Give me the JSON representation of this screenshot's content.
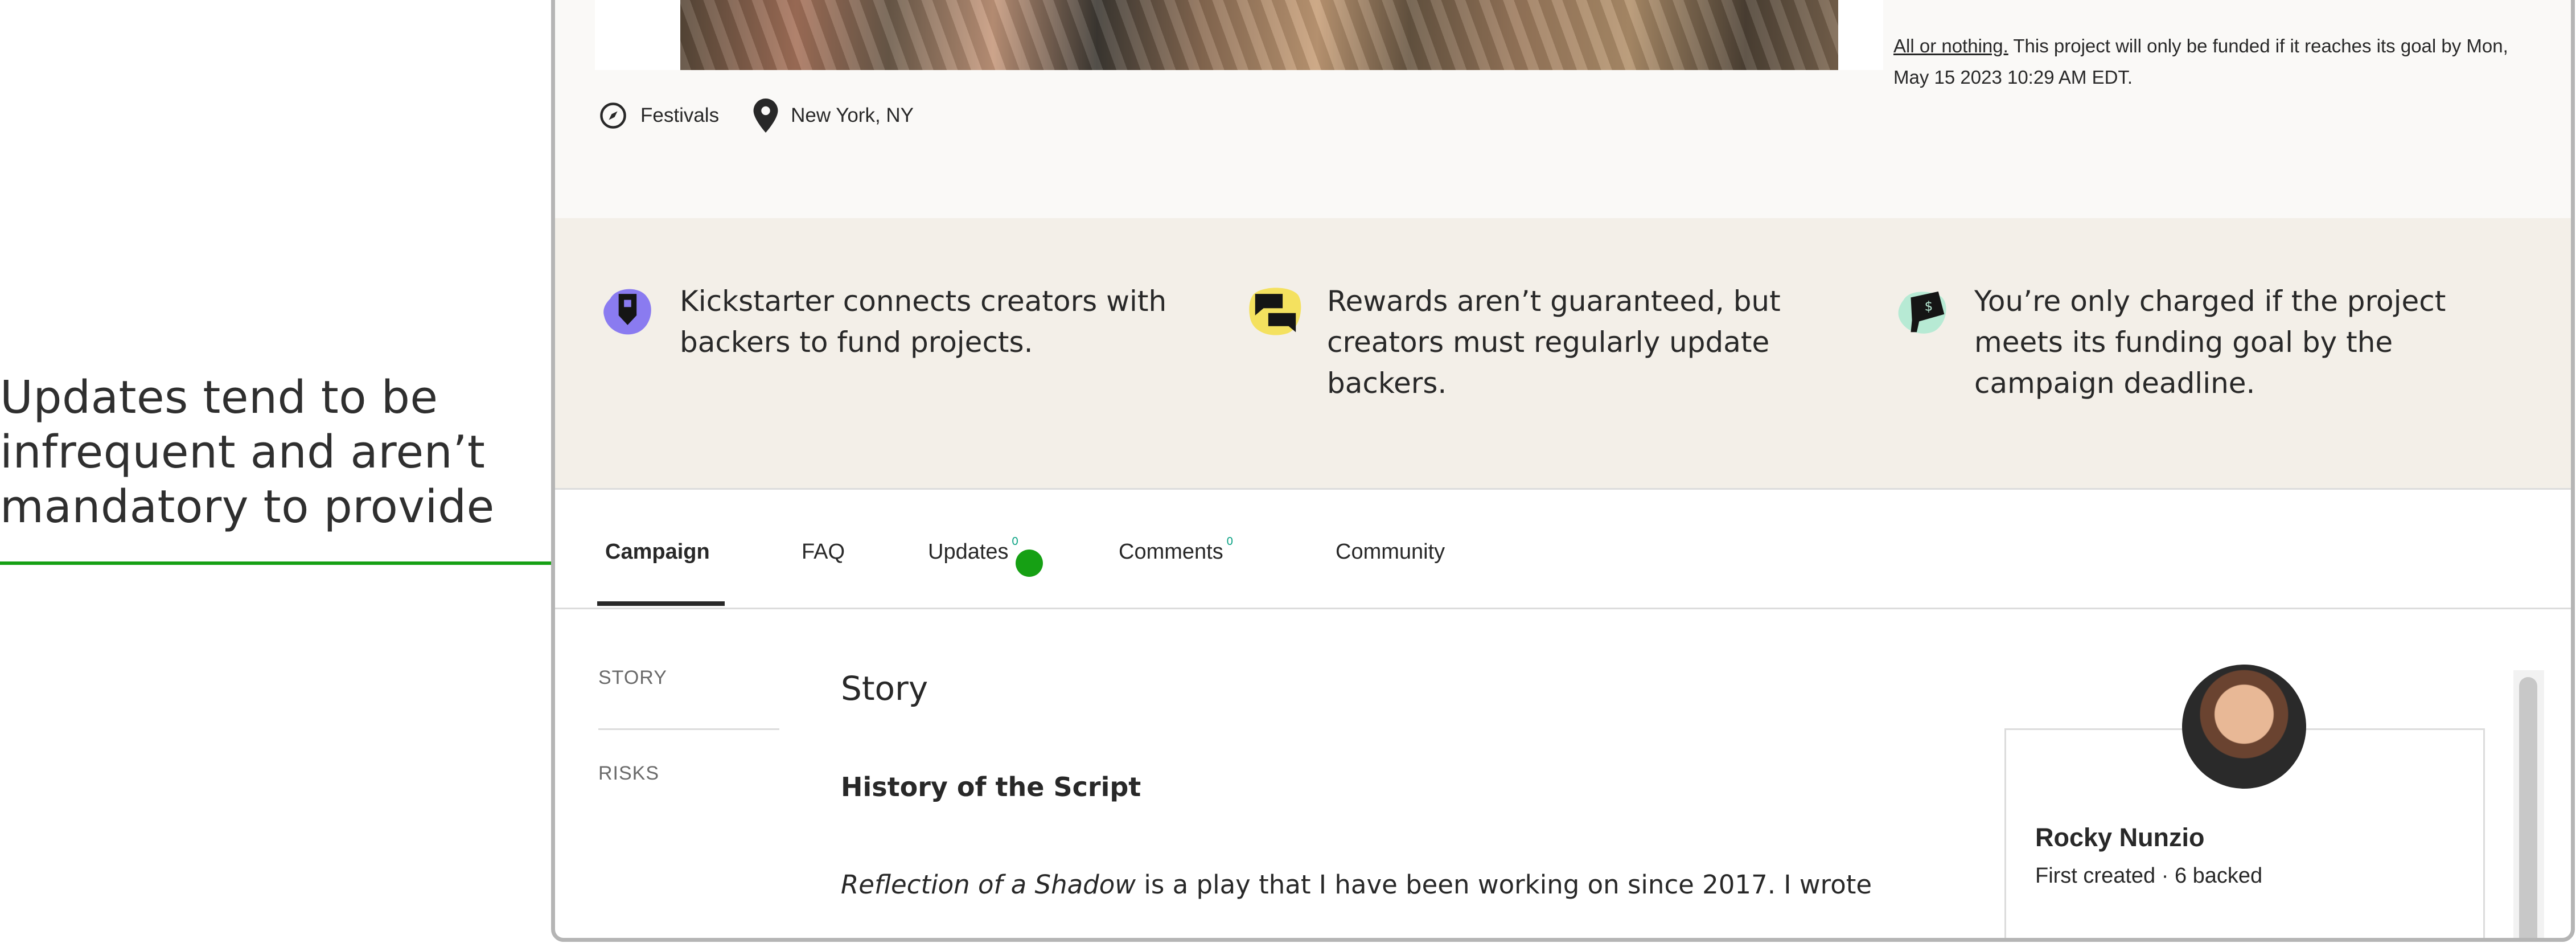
{
  "annotation": {
    "lines": [
      "Updates tend to be",
      "infrequent and aren’t",
      "mandatory to provide"
    ],
    "accent_color": "#16a014"
  },
  "project": {
    "category": "Festivals",
    "category_icon": "compass-icon",
    "location": "New York, NY",
    "location_icon": "location-pin-icon",
    "funding_link": "All or nothing.",
    "funding_text": " This project will only be funded if it reaches its goal by Mon, May 15 2023 10:29 AM EDT."
  },
  "trust": [
    {
      "icon": "kickstarter-connect-icon",
      "text": "Kickstarter connects creators with backers to fund projects."
    },
    {
      "icon": "chat-bubbles-icon",
      "text": "Rewards aren’t guaranteed, but creators must regularly update backers."
    },
    {
      "icon": "megaphone-dollar-icon",
      "text": "You’re only charged if the project meets its funding goal by the campaign deadline."
    }
  ],
  "tabs": [
    {
      "label": "Campaign",
      "count": "",
      "active": true
    },
    {
      "label": "FAQ",
      "count": ""
    },
    {
      "label": "Updates",
      "count": "0"
    },
    {
      "label": "Comments",
      "count": "0"
    },
    {
      "label": "Community",
      "count": ""
    }
  ],
  "sidebar": [
    "STORY",
    "RISKS"
  ],
  "story": {
    "title": "Story",
    "subhead": "History of the Script",
    "para_italic": "Reflection of a Shadow",
    "para_rest": " is a play that I have been working on since 2017. I wrote"
  },
  "creator": {
    "name": "Rocky Nunzio",
    "meta": "First created · 6 backed"
  }
}
